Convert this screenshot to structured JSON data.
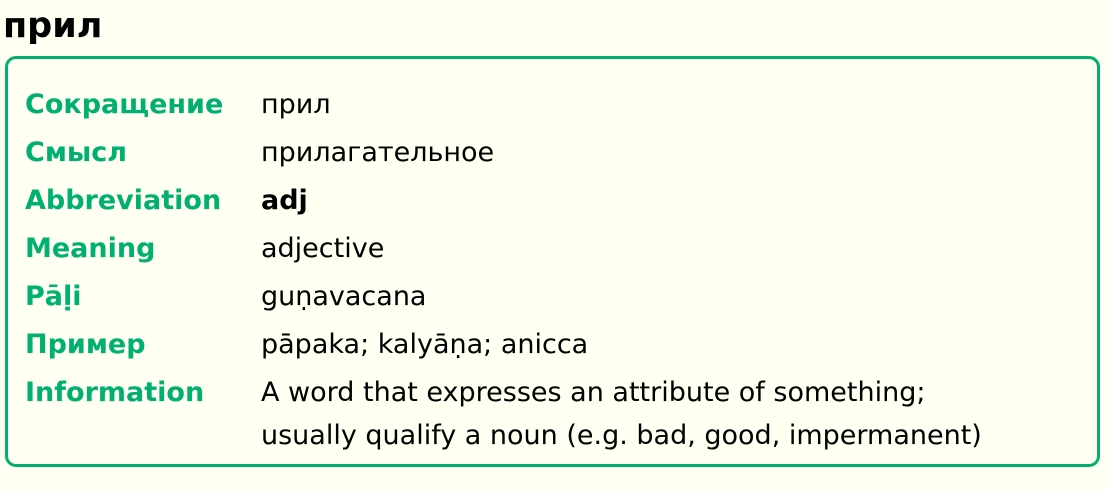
{
  "title": "прил",
  "rows": [
    {
      "label": "Сокращение",
      "value": "прил"
    },
    {
      "label": "Смысл",
      "value": "прилагательное"
    },
    {
      "label": "Abbreviation",
      "value": "adj"
    },
    {
      "label": "Meaning",
      "value": "adjective"
    },
    {
      "label": "Pāḷi",
      "value": "guṇavacana"
    },
    {
      "label": "Пример",
      "value": "pāpaka; kalyāṇa; anicca"
    },
    {
      "label": "Information",
      "value_lines": [
        "A word that expresses an attribute of something;",
        "usually qualify a noun (e.g. bad, good, impermanent)"
      ]
    }
  ],
  "colors": {
    "accent": "#00b070",
    "background": "#fffff2"
  }
}
